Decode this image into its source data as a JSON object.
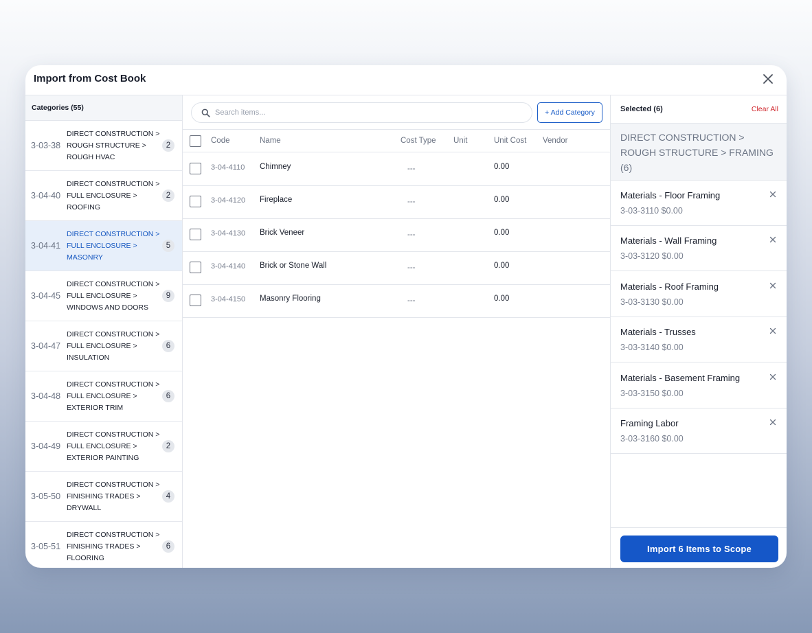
{
  "modal": {
    "title": "Import from Cost Book"
  },
  "categories": {
    "header": "Categories (55)",
    "items": [
      {
        "code": "3-03-38",
        "label": "DIRECT CONSTRUCTION > ROUGH STRUCTURE > ROUGH HVAC",
        "count": "2",
        "active": false
      },
      {
        "code": "3-04-40",
        "label": "DIRECT CONSTRUCTION > FULL ENCLOSURE > ROOFING",
        "count": "2",
        "active": false
      },
      {
        "code": "3-04-41",
        "label": "DIRECT CONSTRUCTION > FULL ENCLOSURE > MASONRY",
        "count": "5",
        "active": true
      },
      {
        "code": "3-04-45",
        "label": "DIRECT CONSTRUCTION > FULL ENCLOSURE > WINDOWS AND DOORS",
        "count": "9",
        "active": false
      },
      {
        "code": "3-04-47",
        "label": "DIRECT CONSTRUCTION > FULL ENCLOSURE > INSULATION",
        "count": "6",
        "active": false
      },
      {
        "code": "3-04-48",
        "label": "DIRECT CONSTRUCTION > FULL ENCLOSURE > EXTERIOR TRIM",
        "count": "6",
        "active": false
      },
      {
        "code": "3-04-49",
        "label": "DIRECT CONSTRUCTION > FULL ENCLOSURE > EXTERIOR PAINTING",
        "count": "2",
        "active": false
      },
      {
        "code": "3-05-50",
        "label": "DIRECT CONSTRUCTION > FINISHING TRADES > DRYWALL",
        "count": "4",
        "active": false
      },
      {
        "code": "3-05-51",
        "label": "DIRECT CONSTRUCTION > FINISHING TRADES > FLOORING",
        "count": "6",
        "active": false
      }
    ]
  },
  "search": {
    "placeholder": "Search items..."
  },
  "add_category_label": "+ Add Category",
  "table": {
    "columns": {
      "code": "Code",
      "name": "Name",
      "cost_type": "Cost Type",
      "unit": "Unit",
      "unit_cost": "Unit Cost",
      "vendor": "Vendor"
    },
    "rows": [
      {
        "code": "3-04-4110",
        "name": "Chimney",
        "cost_type": "---",
        "unit": "",
        "unit_cost": "0.00",
        "vendor": ""
      },
      {
        "code": "3-04-4120",
        "name": "Fireplace",
        "cost_type": "---",
        "unit": "",
        "unit_cost": "0.00",
        "vendor": ""
      },
      {
        "code": "3-04-4130",
        "name": "Brick Veneer",
        "cost_type": "---",
        "unit": "",
        "unit_cost": "0.00",
        "vendor": ""
      },
      {
        "code": "3-04-4140",
        "name": "Brick or Stone Wall",
        "cost_type": "---",
        "unit": "",
        "unit_cost": "0.00",
        "vendor": ""
      },
      {
        "code": "3-04-4150",
        "name": "Masonry Flooring",
        "cost_type": "---",
        "unit": "",
        "unit_cost": "0.00",
        "vendor": ""
      }
    ]
  },
  "selected": {
    "header": "Selected (6)",
    "clear_all": "Clear All",
    "group": "DIRECT CONSTRUCTION > ROUGH STRUCTURE > FRAMING (6)",
    "items": [
      {
        "name": "Materials - Floor Framing",
        "meta": "3-03-3110 $0.00"
      },
      {
        "name": "Materials - Wall Framing",
        "meta": "3-03-3120 $0.00"
      },
      {
        "name": "Materials - Roof Framing",
        "meta": "3-03-3130 $0.00"
      },
      {
        "name": "Materials - Trusses",
        "meta": "3-03-3140 $0.00"
      },
      {
        "name": "Materials - Basement Framing",
        "meta": "3-03-3150 $0.00"
      },
      {
        "name": "Framing Labor",
        "meta": "3-03-3160 $0.00"
      }
    ]
  },
  "import_button": "Import 6 Items to Scope",
  "colors": {
    "accent": "#1557c8",
    "danger": "#d0262c",
    "active_bg": "#e7effa"
  }
}
